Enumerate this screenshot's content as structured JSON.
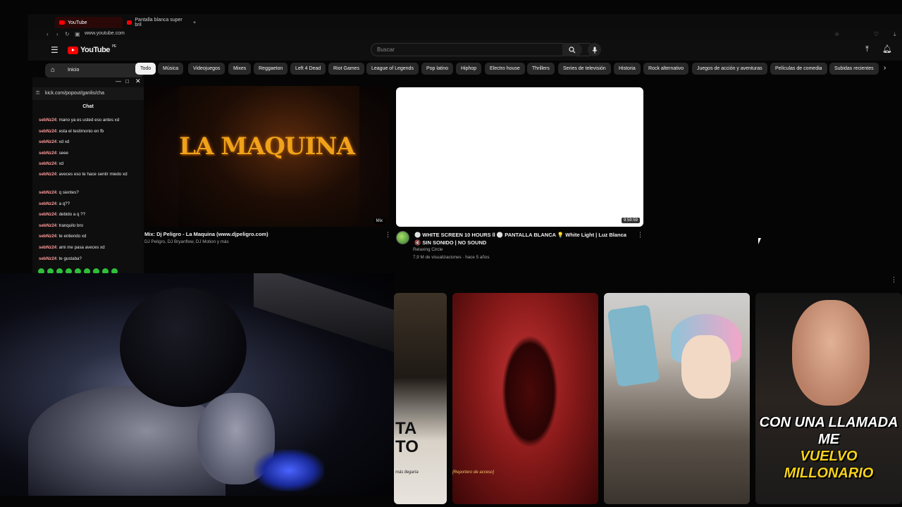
{
  "browser": {
    "tabs": [
      {
        "label": "YouTube",
        "active": true
      },
      {
        "label": "Pantalla blanca super bril",
        "active": false
      }
    ],
    "new_tab": "+",
    "url": "www.youtube.com"
  },
  "youtube": {
    "logo": "YouTube",
    "country_code": "PE",
    "search_placeholder": "Buscar",
    "chips": [
      "Todo",
      "Música",
      "Videojuegos",
      "Mixes",
      "Reggaeton",
      "Left 4 Dead",
      "Riot Games",
      "League of Legends",
      "Pop latino",
      "Hiphop",
      "Electro house",
      "Thrillers",
      "Series de televisión",
      "Historia",
      "Rock alternativo",
      "Juegos de acción y aventuras",
      "Películas de comedia",
      "Subidas recientes"
    ],
    "sidebar": {
      "home_label": "Inicio"
    },
    "videos": [
      {
        "thumb_text": "LA MAQUINA",
        "badge": "Mix",
        "title": "Mix: Dj Peligro - La Maquina (www.djpeligro.com)",
        "meta": "DJ Peligro, DJ Bryanflow, DJ Motion y más"
      },
      {
        "duration": "9:59:59",
        "title_line1": "⚪ WHITE SCREEN 10 HOURS ll ⚪ PANTALLA BLANCA 💡 White Light | Luz Blanca",
        "title_line2": "🔇 SIN SONIDO | NO SOUND",
        "channel": "Relaxing Circle",
        "views": "7,9 M de visualizaciones · hace 5 años"
      }
    ],
    "shorts": [
      {
        "big_text": "TA\nTO",
        "sub": "más llegaría"
      },
      {
        "caption": "[Reportero de acceso]"
      },
      {},
      {
        "caption_line1": "CON UNA LLAMADA ME",
        "caption_line2": "VUELVO MILLONARIO"
      }
    ]
  },
  "kick": {
    "url": "kick.com/popout/ganlis/cha",
    "title": "Chat",
    "messages": [
      {
        "user": "sebNz24",
        "text": "mano ya es usted eso antes xd"
      },
      {
        "user": "sebNz24",
        "text": "esta el testimonio en fb"
      },
      {
        "user": "sebNz24",
        "text": "xd xd"
      },
      {
        "user": "sebNz24",
        "text": "seee"
      },
      {
        "user": "sebNz24",
        "text": "xd"
      },
      {
        "user": "sebNz24",
        "text": "aveces eso te hace sentir miedo xd"
      },
      {
        "user": "sebNz24",
        "text": "q sientes?"
      },
      {
        "user": "sebNz24",
        "text": "a q??"
      },
      {
        "user": "sebNz24",
        "text": "debido a q ??"
      },
      {
        "user": "sebNz24",
        "text": "tranquilo bro"
      },
      {
        "user": "sebNz24",
        "text": "te entiendo xd"
      },
      {
        "user": "sebNz24",
        "text": "ami me pasa aveces xd"
      },
      {
        "user": "sebNz24",
        "text": "te gustaba?"
      }
    ]
  },
  "colors": {
    "youtube_red": "#ff0000",
    "chat_user": "#ff9a9a",
    "background": "#0f0f0f",
    "emote_green": "#2fbf3a"
  }
}
